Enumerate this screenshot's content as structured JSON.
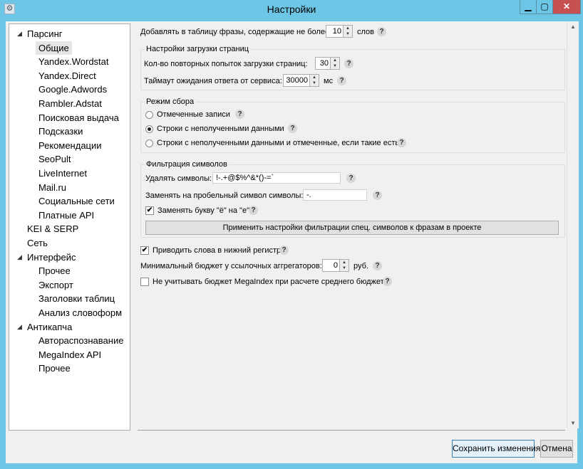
{
  "window": {
    "title": "Настройки"
  },
  "tree": [
    {
      "label": "Парсинг",
      "level": 0,
      "expanded": true
    },
    {
      "label": "Общие",
      "level": 1,
      "selected": true
    },
    {
      "label": "Yandex.Wordstat",
      "level": 1
    },
    {
      "label": "Yandex.Direct",
      "level": 1
    },
    {
      "label": "Google.Adwords",
      "level": 1
    },
    {
      "label": "Rambler.Adstat",
      "level": 1
    },
    {
      "label": "Поисковая выдача",
      "level": 1
    },
    {
      "label": "Подсказки",
      "level": 1
    },
    {
      "label": "Рекомендации",
      "level": 1
    },
    {
      "label": "SeoPult",
      "level": 1
    },
    {
      "label": "LiveInternet",
      "level": 1
    },
    {
      "label": "Mail.ru",
      "level": 1
    },
    {
      "label": "Социальные сети",
      "level": 1
    },
    {
      "label": "Платные API",
      "level": 1
    },
    {
      "label": "KEI & SERP",
      "level": 0
    },
    {
      "label": "Сеть",
      "level": 0
    },
    {
      "label": "Интерфейс",
      "level": 0,
      "expanded": true
    },
    {
      "label": "Прочее",
      "level": 1
    },
    {
      "label": "Экспорт",
      "level": 1
    },
    {
      "label": "Заголовки таблиц",
      "level": 1
    },
    {
      "label": "Анализ словоформ",
      "level": 1
    },
    {
      "label": "Антикапча",
      "level": 0,
      "expanded": true
    },
    {
      "label": "Автораспознавание",
      "level": 1
    },
    {
      "label": "MegaIndex API",
      "level": 1
    },
    {
      "label": "Прочее",
      "level": 1
    }
  ],
  "settings": {
    "add_phrases": {
      "label": "Добавлять в таблицу фразы, содержащие не более",
      "value": "10",
      "unit": "слов"
    },
    "page_load": {
      "title": "Настройки загрузки страниц",
      "retries_label": "Кол-во повторных попыток загрузки страниц:",
      "retries_value": "30",
      "timeout_label": "Таймаут ожидания ответа от сервиса:",
      "timeout_value": "30000",
      "timeout_unit": "мс"
    },
    "collect_mode": {
      "title": "Режим сбора",
      "options": [
        {
          "label": "Отмеченные записи",
          "selected": false
        },
        {
          "label": "Строки с неполученными данными",
          "selected": true
        },
        {
          "label": "Строки с неполученными данными и отмеченные, если такие есть",
          "selected": false
        }
      ]
    },
    "symbol_filter": {
      "title": "Фильтрация символов",
      "remove_label": "Удалять символы:",
      "remove_value": "!-.+@$%^&*()-=`",
      "replace_label": "Заменять на пробельный символ символы:",
      "replace_value": "-.",
      "yo_label": "Заменять букву \"ё\" на \"е\"",
      "yo_checked": true,
      "apply_button": "Применить настройки фильтрации спец. символов к фразам в проекте"
    },
    "lowercase": {
      "label": "Приводить слова в нижний регистр",
      "checked": true
    },
    "min_budget": {
      "label": "Минимальный бюджет у ссылочных аггрегаторов:",
      "value": "0",
      "unit": "руб."
    },
    "ignore_megaindex": {
      "label": "Не учитывать бюджет MegaIndex при расчете среднего бюджета",
      "checked": false
    }
  },
  "footer": {
    "save": "Сохранить изменения",
    "cancel": "Отмена"
  },
  "icons": {
    "help": "?",
    "window": "settings-gear-icon",
    "check": "✔"
  }
}
